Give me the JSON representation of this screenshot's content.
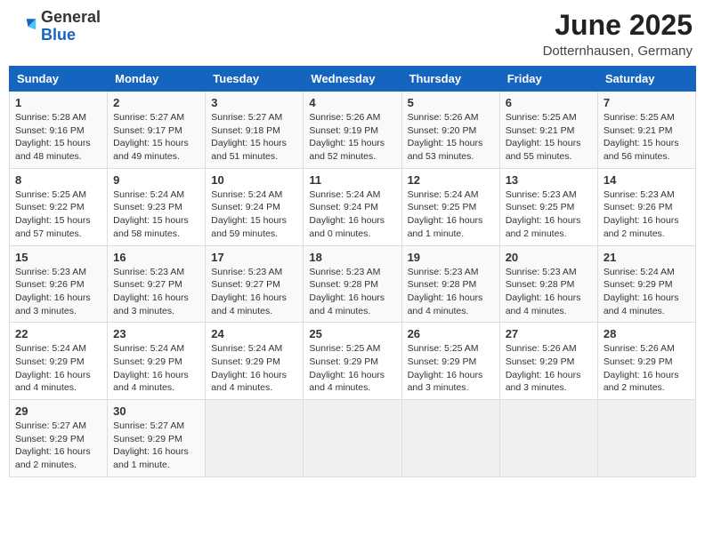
{
  "logo": {
    "general": "General",
    "blue": "Blue"
  },
  "header": {
    "title": "June 2025",
    "location": "Dotternhausen, Germany"
  },
  "weekdays": [
    "Sunday",
    "Monday",
    "Tuesday",
    "Wednesday",
    "Thursday",
    "Friday",
    "Saturday"
  ],
  "weeks": [
    [
      {
        "day": "1",
        "sunrise": "5:28 AM",
        "sunset": "9:16 PM",
        "daylight": "15 hours and 48 minutes."
      },
      {
        "day": "2",
        "sunrise": "5:27 AM",
        "sunset": "9:17 PM",
        "daylight": "15 hours and 49 minutes."
      },
      {
        "day": "3",
        "sunrise": "5:27 AM",
        "sunset": "9:18 PM",
        "daylight": "15 hours and 51 minutes."
      },
      {
        "day": "4",
        "sunrise": "5:26 AM",
        "sunset": "9:19 PM",
        "daylight": "15 hours and 52 minutes."
      },
      {
        "day": "5",
        "sunrise": "5:26 AM",
        "sunset": "9:20 PM",
        "daylight": "15 hours and 53 minutes."
      },
      {
        "day": "6",
        "sunrise": "5:25 AM",
        "sunset": "9:21 PM",
        "daylight": "15 hours and 55 minutes."
      },
      {
        "day": "7",
        "sunrise": "5:25 AM",
        "sunset": "9:21 PM",
        "daylight": "15 hours and 56 minutes."
      }
    ],
    [
      {
        "day": "8",
        "sunrise": "5:25 AM",
        "sunset": "9:22 PM",
        "daylight": "15 hours and 57 minutes."
      },
      {
        "day": "9",
        "sunrise": "5:24 AM",
        "sunset": "9:23 PM",
        "daylight": "15 hours and 58 minutes."
      },
      {
        "day": "10",
        "sunrise": "5:24 AM",
        "sunset": "9:24 PM",
        "daylight": "15 hours and 59 minutes."
      },
      {
        "day": "11",
        "sunrise": "5:24 AM",
        "sunset": "9:24 PM",
        "daylight": "16 hours and 0 minutes."
      },
      {
        "day": "12",
        "sunrise": "5:24 AM",
        "sunset": "9:25 PM",
        "daylight": "16 hours and 1 minute."
      },
      {
        "day": "13",
        "sunrise": "5:23 AM",
        "sunset": "9:25 PM",
        "daylight": "16 hours and 2 minutes."
      },
      {
        "day": "14",
        "sunrise": "5:23 AM",
        "sunset": "9:26 PM",
        "daylight": "16 hours and 2 minutes."
      }
    ],
    [
      {
        "day": "15",
        "sunrise": "5:23 AM",
        "sunset": "9:26 PM",
        "daylight": "16 hours and 3 minutes."
      },
      {
        "day": "16",
        "sunrise": "5:23 AM",
        "sunset": "9:27 PM",
        "daylight": "16 hours and 3 minutes."
      },
      {
        "day": "17",
        "sunrise": "5:23 AM",
        "sunset": "9:27 PM",
        "daylight": "16 hours and 4 minutes."
      },
      {
        "day": "18",
        "sunrise": "5:23 AM",
        "sunset": "9:28 PM",
        "daylight": "16 hours and 4 minutes."
      },
      {
        "day": "19",
        "sunrise": "5:23 AM",
        "sunset": "9:28 PM",
        "daylight": "16 hours and 4 minutes."
      },
      {
        "day": "20",
        "sunrise": "5:23 AM",
        "sunset": "9:28 PM",
        "daylight": "16 hours and 4 minutes."
      },
      {
        "day": "21",
        "sunrise": "5:24 AM",
        "sunset": "9:29 PM",
        "daylight": "16 hours and 4 minutes."
      }
    ],
    [
      {
        "day": "22",
        "sunrise": "5:24 AM",
        "sunset": "9:29 PM",
        "daylight": "16 hours and 4 minutes."
      },
      {
        "day": "23",
        "sunrise": "5:24 AM",
        "sunset": "9:29 PM",
        "daylight": "16 hours and 4 minutes."
      },
      {
        "day": "24",
        "sunrise": "5:24 AM",
        "sunset": "9:29 PM",
        "daylight": "16 hours and 4 minutes."
      },
      {
        "day": "25",
        "sunrise": "5:25 AM",
        "sunset": "9:29 PM",
        "daylight": "16 hours and 4 minutes."
      },
      {
        "day": "26",
        "sunrise": "5:25 AM",
        "sunset": "9:29 PM",
        "daylight": "16 hours and 3 minutes."
      },
      {
        "day": "27",
        "sunrise": "5:26 AM",
        "sunset": "9:29 PM",
        "daylight": "16 hours and 3 minutes."
      },
      {
        "day": "28",
        "sunrise": "5:26 AM",
        "sunset": "9:29 PM",
        "daylight": "16 hours and 2 minutes."
      }
    ],
    [
      {
        "day": "29",
        "sunrise": "5:27 AM",
        "sunset": "9:29 PM",
        "daylight": "16 hours and 2 minutes."
      },
      {
        "day": "30",
        "sunrise": "5:27 AM",
        "sunset": "9:29 PM",
        "daylight": "16 hours and 1 minute."
      },
      null,
      null,
      null,
      null,
      null
    ]
  ]
}
